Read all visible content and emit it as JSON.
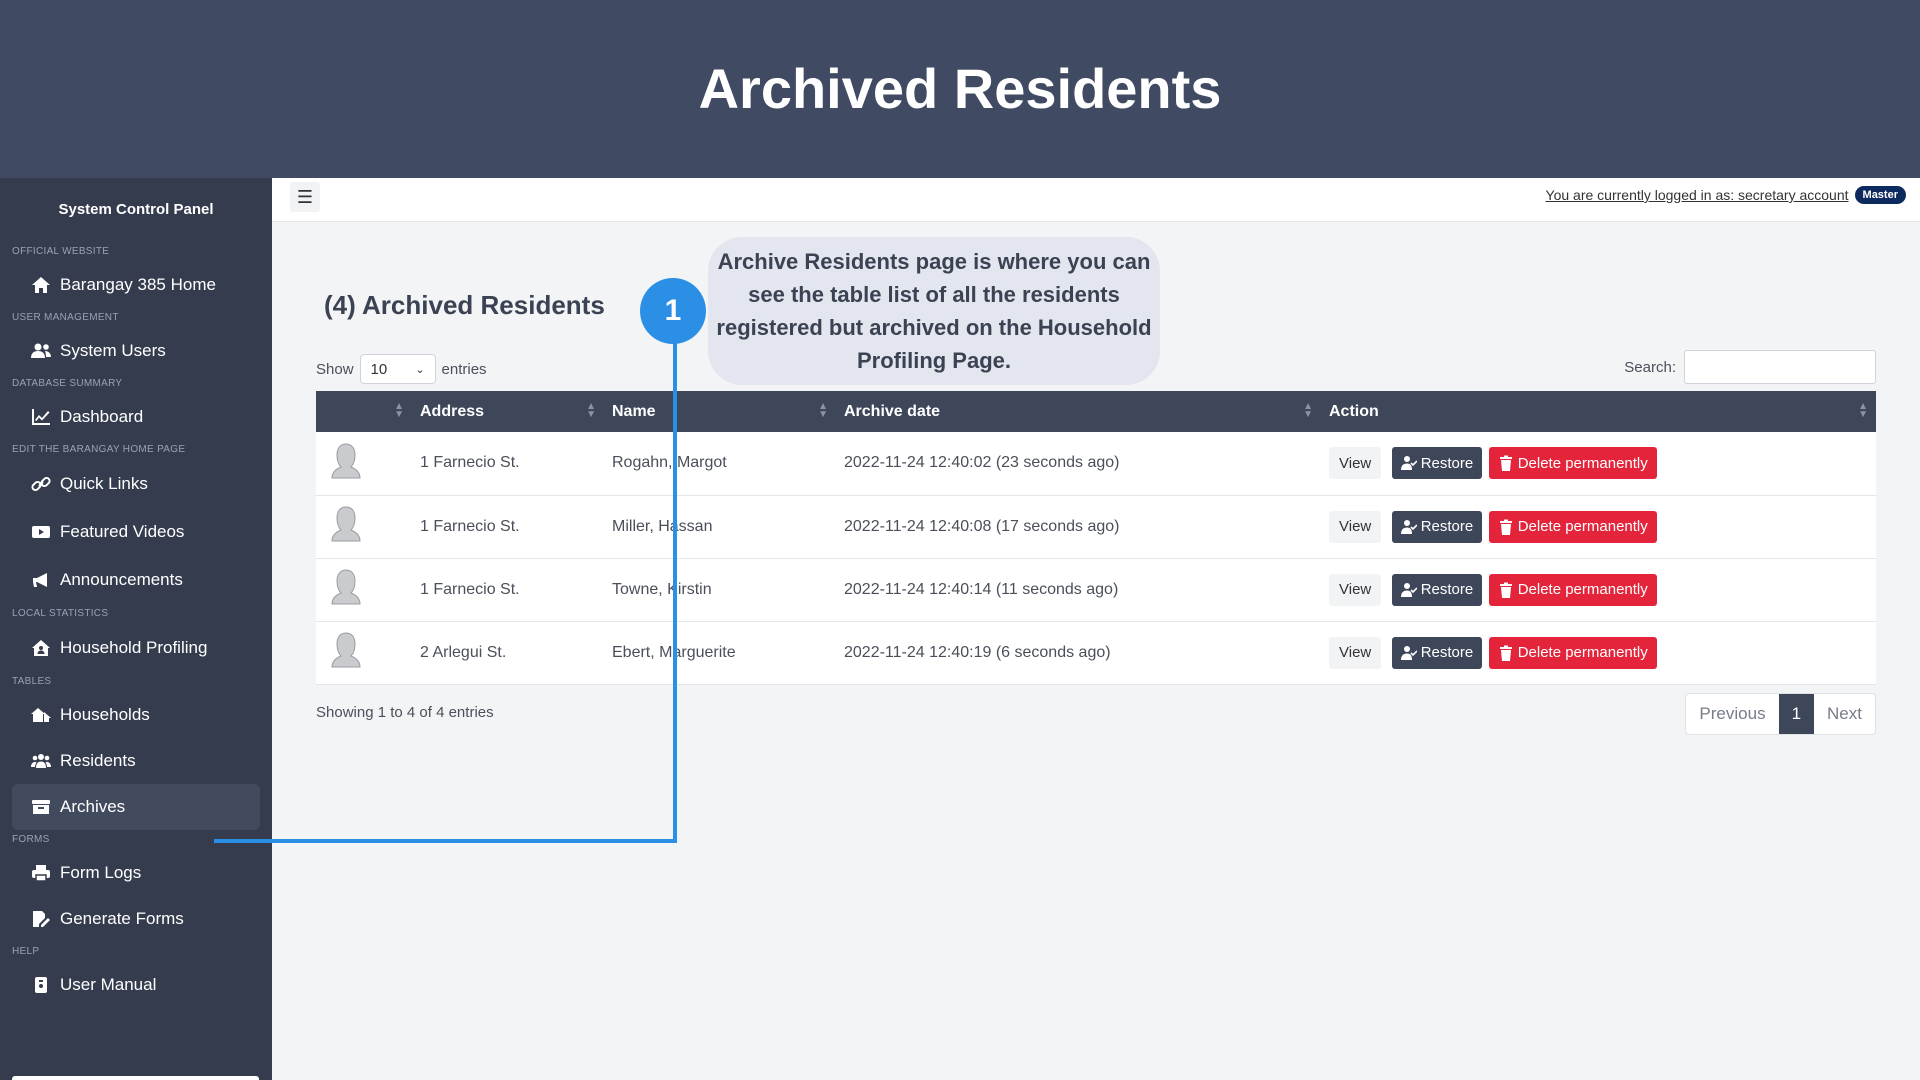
{
  "banner": {
    "title": "Archived Residents"
  },
  "sidebar": {
    "title": "System Control Panel",
    "sections": {
      "official": "OFFICIAL WEBSITE",
      "user_mgmt": "USER MANAGEMENT",
      "db_summary": "DATABASE SUMMARY",
      "edit_home": "EDIT THE BARANGAY HOME PAGE",
      "local_stats": "LOCAL STATISTICS",
      "tables": "TABLES",
      "forms": "FORMS",
      "help": "HELP"
    },
    "items": {
      "home": "Barangay 385 Home",
      "system_users": "System Users",
      "dashboard": "Dashboard",
      "quick_links": "Quick Links",
      "featured_videos": "Featured Videos",
      "announcements": "Announcements",
      "household_profiling": "Household Profiling",
      "households": "Households",
      "residents": "Residents",
      "archives": "Archives",
      "form_logs": "Form Logs",
      "generate_forms": "Generate Forms",
      "user_manual": "User Manual"
    },
    "icons": [
      "home-icon",
      "users-icon",
      "chart-line-icon",
      "link-icon",
      "video-icon",
      "bullhorn-icon",
      "house-user-icon",
      "houses-icon",
      "people-icon",
      "archive-box-icon",
      "print-icon",
      "form-edit-icon",
      "book-icon"
    ]
  },
  "topbar": {
    "logged_in_text": "You are currently logged in as: secretary account",
    "role_badge": "Master"
  },
  "main": {
    "heading": "(4) Archived Residents",
    "show_label": "Show",
    "entries_select": "10",
    "entries_label": "entries",
    "search_label": "Search:",
    "columns": [
      "",
      "Address",
      "Name",
      "Archive date",
      "Action"
    ],
    "rows": [
      {
        "address": "1 Farnecio St.",
        "name": "Rogahn, Margot",
        "archive_date": "2022-11-24 12:40:02 (23 seconds ago)"
      },
      {
        "address": "1 Farnecio St.",
        "name": "Miller, Hassan",
        "archive_date": "2022-11-24 12:40:08 (17 seconds ago)"
      },
      {
        "address": "1 Farnecio St.",
        "name": "Towne, Kirstin",
        "archive_date": "2022-11-24 12:40:14 (11 seconds ago)"
      },
      {
        "address": "2 Arlegui St.",
        "name": "Ebert, Marguerite",
        "archive_date": "2022-11-24 12:40:19 (6 seconds ago)"
      }
    ],
    "actions": {
      "view": "View",
      "restore": "Restore",
      "delete": "Delete permanently"
    },
    "showing_text": "Showing 1 to 4 of 4 entries",
    "pagination": {
      "previous": "Previous",
      "current": "1",
      "next": "Next"
    }
  },
  "annotation": {
    "step": "1",
    "text": "Archive Residents page is where you can see the table list of all the residents registered but archived on the Household Profiling Page."
  },
  "colors": {
    "banner": "#404a62",
    "sidebar": "#353c4e",
    "accent": "#2c8fe6",
    "danger": "#e3243b",
    "table_header": "#3e4659"
  }
}
